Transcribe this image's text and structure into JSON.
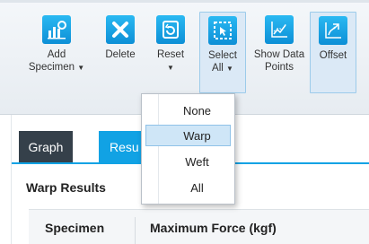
{
  "ribbon": {
    "buttons": [
      {
        "label": "Add",
        "label2": "Specimen",
        "caret": true,
        "icon": "add-specimen-icon"
      },
      {
        "label": "Delete",
        "label2": "",
        "caret": false,
        "icon": "delete-icon"
      },
      {
        "label": "Reset",
        "label2": "",
        "caret": true,
        "icon": "reset-icon"
      },
      {
        "label": "Select",
        "label2": "All",
        "caret": true,
        "icon": "select-all-icon"
      },
      {
        "label": "Show Data",
        "label2": "Points",
        "caret": false,
        "icon": "show-data-points-icon"
      },
      {
        "label": "Offset",
        "label2": "",
        "caret": false,
        "icon": "offset-icon"
      }
    ]
  },
  "tabs": {
    "graph": "Graph",
    "results": "Resu"
  },
  "results": {
    "title": "Warp Results",
    "columns": [
      "Specimen",
      "Maximum Force (kgf)"
    ]
  },
  "dropdown": {
    "items": [
      "None",
      "Warp",
      "Weft",
      "All"
    ],
    "selected": "Warp"
  },
  "colors": {
    "accent": "#11a2e4",
    "icon_blue": "#1aa7e8",
    "tab_dark": "#35404a",
    "highlight": "#cfe6f7"
  }
}
